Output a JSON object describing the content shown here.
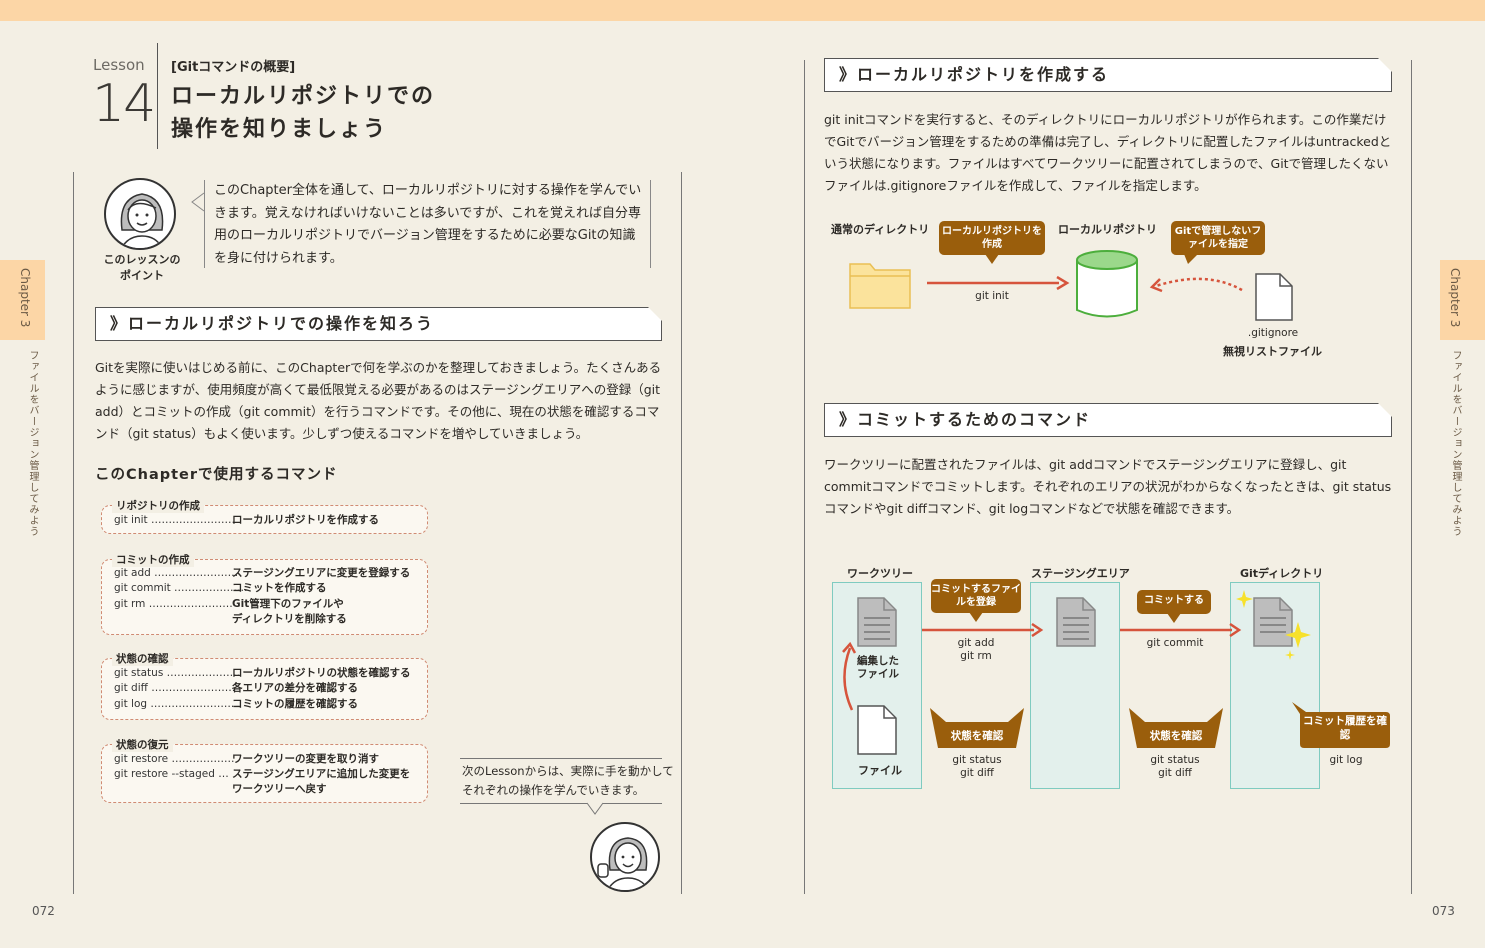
{
  "lesson": {
    "word": "Lesson",
    "number": "14",
    "category": "[Gitコマンドの概要]",
    "title_line1": "ローカルリポジトリでの",
    "title_line2": "操作を知りましょう"
  },
  "point": {
    "label_line1": "このレッスンの",
    "label_line2": "ポイント",
    "text": "このChapter全体を通して、ローカルリポジトリに対する操作を学んでいきます。覚えなければいけないことは多いですが、これを覚えれば自分専用のローカルリポジトリでバージョン管理をするために必要なGitの知識を身に付けられます。"
  },
  "left_section": {
    "heading": "》ローカルリポジトリでの操作を知ろう",
    "paragraph": "Gitを実際に使いはじめる前に、このChapterで何を学ぶのかを整理しておきましょう。たくさんあるように感じますが、使用頻度が高くて最低限覚える必要があるのはステージングエリアへの登録（git add）とコミットの作成（git commit）を行うコマンドです。その他に、現在の状態を確認するコマンド（git status）もよく使います。少しずつ使えるコマンドを増やしていきましょう。"
  },
  "commands": {
    "heading": "このChapterで使用するコマンド",
    "groups": [
      {
        "title": "リポジトリの作成",
        "rows": [
          {
            "cmd": "git init ……………………",
            "desc": "ローカルリポジトリを作成する"
          }
        ]
      },
      {
        "title": "コミットの作成",
        "rows": [
          {
            "cmd": "git add ……………………",
            "desc": "ステージングエリアに変更を登録する"
          },
          {
            "cmd": "git commit …………………",
            "desc": "コミットを作成する"
          },
          {
            "cmd": "git rm ……………………",
            "desc": "Git管理下のファイルや"
          },
          {
            "cmd": "",
            "desc": "ディレクトリを削除する"
          }
        ]
      },
      {
        "title": "状態の確認",
        "rows": [
          {
            "cmd": "git status …………………",
            "desc": "ローカルリポジトリの状態を確認する"
          },
          {
            "cmd": "git diff ……………………",
            "desc": "各エリアの差分を確認する"
          },
          {
            "cmd": "git log ……………………",
            "desc": "コミットの履歴を確認する"
          }
        ]
      },
      {
        "title": "状態の復元",
        "rows": [
          {
            "cmd": "git restore ………………",
            "desc": "ワークツリーの変更を取り消す"
          },
          {
            "cmd": "git restore --staged …",
            "desc": "ステージングエリアに追加した変更を"
          },
          {
            "cmd": "",
            "desc": "ワークツリーへ戻す"
          }
        ]
      }
    ]
  },
  "next_lesson_text": "次のLessonからは、実際に手を動かしてそれぞれの操作を学んでいきます。",
  "right_section1": {
    "heading": "》ローカルリポジトリを作成する",
    "paragraph": "git initコマンドを実行すると、そのディレクトリにローカルリポジトリが作られます。この作業だけでGitでバージョン管理をするための準備は完了し、ディレクトリに配置したファイルはuntrackedという状態になります。ファイルはすべてワークツリーに配置されてしまうので、Gitで管理したくないファイルは.gitignoreファイルを作成して、ファイルを指定します。"
  },
  "diagram1": {
    "normal_dir": "通常のディレクトリ",
    "callout_create": "ローカルリポジトリを作成",
    "cmd": "git init",
    "local_repo": "ローカルリポジトリ",
    "callout_ignore": "Gitで管理しないファイルを指定",
    "gitignore": ".gitignore",
    "ignore_list": "無視リストファイル",
    "colors": {
      "folder": "#fbe39c",
      "repo": "#9bd88b",
      "arrow": "#d6543c",
      "callout": "#9a5e0c"
    }
  },
  "right_section2": {
    "heading": "》コミットするためのコマンド",
    "paragraph": "ワークツリーに配置されたファイルは、git addコマンドでステージングエリアに登録し、git commitコマンドでコミットします。それぞれのエリアの状況がわからなくなったときは、git statusコマンドやgit diffコマンド、git logコマンドなどで状態を確認できます。"
  },
  "diagram2": {
    "worktree": "ワークツリー",
    "staging": "ステージングエリア",
    "gitdir": "Gitディレクトリ",
    "callout_register": "コミットするファイルを登録",
    "callout_commit": "コミットする",
    "cmd_add": "git add",
    "cmd_rm": "git rm",
    "cmd_commit": "git commit",
    "edited_file": "編集したファイル",
    "file": "ファイル",
    "check_state": "状態を確認",
    "check_state2": "状態を確認",
    "status_diff_1": "git status",
    "diff_1": "git diff",
    "status_diff_2": "git status",
    "diff_2": "git diff",
    "check_history": "コミット履歴を確認",
    "cmd_log": "git log"
  },
  "side": {
    "tab": "Chapter 3",
    "caption": "ファイルをバージョン管理してみよう"
  },
  "folio_left": "072",
  "folio_right": "073",
  "colors": {
    "topbar": "#fcd6a6",
    "page": "#f3efe4",
    "dashed": "#d08b73",
    "area": "#e3f0ec",
    "area_border": "#7fcbc0"
  }
}
